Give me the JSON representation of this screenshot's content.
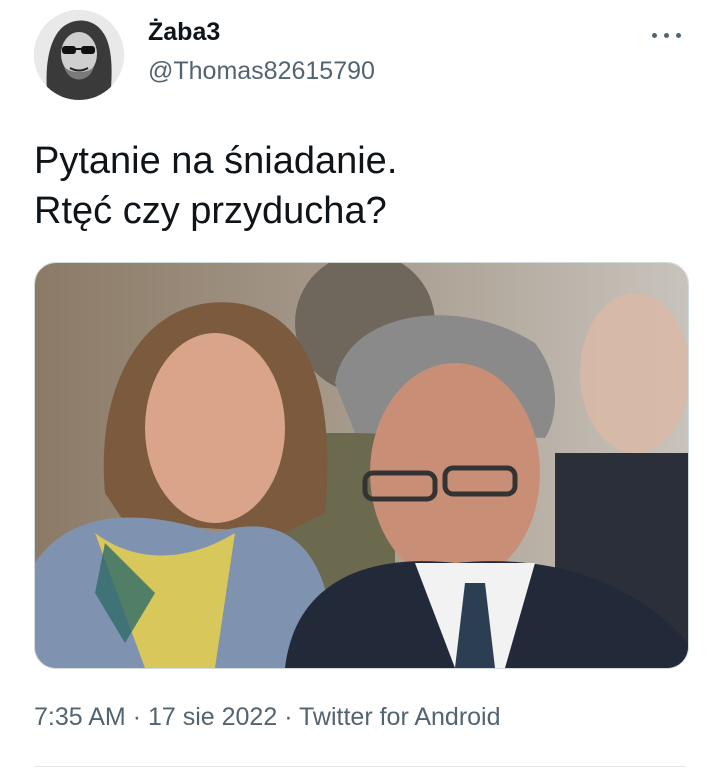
{
  "author": {
    "display_name": "Żaba3",
    "handle": "@Thomas82615790",
    "avatar_icon": "avatar-photo"
  },
  "more_icon": "more-horizontal-icon",
  "tweet": {
    "lines": [
      "Pytanie na śniadanie.",
      "Rtęć czy przyducha?"
    ]
  },
  "meta": {
    "time": "7:35 AM",
    "date": "17 sie 2022",
    "source": "Twitter for Android",
    "separator": "·"
  },
  "colors": {
    "text_primary": "#0f1419",
    "text_secondary": "#536471",
    "border": "#cfd9de"
  }
}
